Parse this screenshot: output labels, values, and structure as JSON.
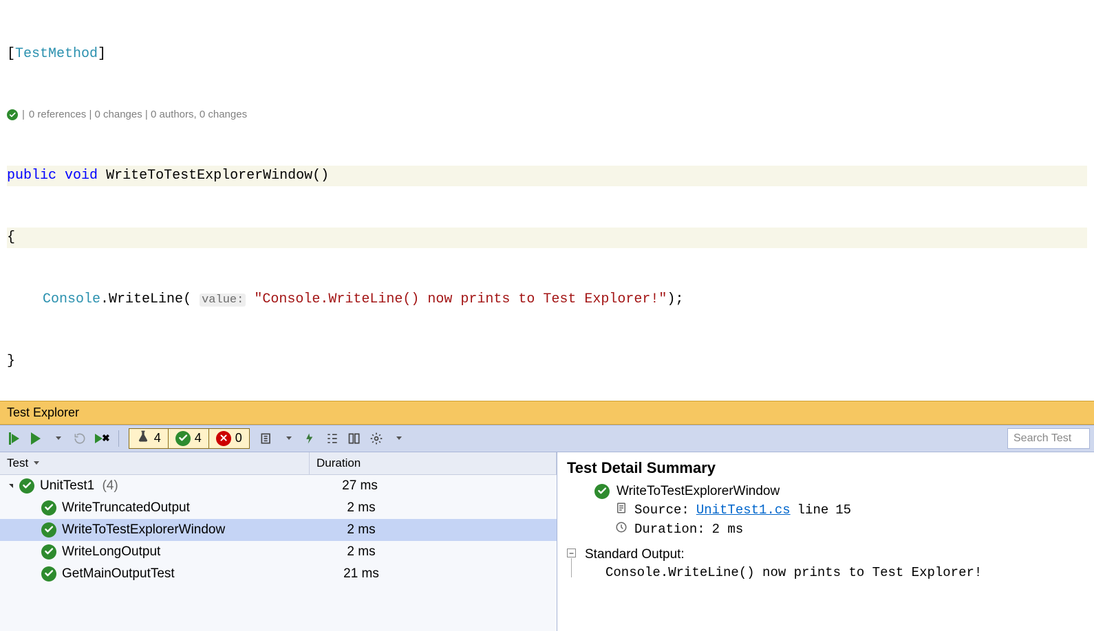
{
  "code": {
    "attr_open": "[",
    "attr_name": "TestMethod",
    "attr_close": "]",
    "codelens": "0 references | 0 changes | 0 authors, 0 changes",
    "kw_public": "public",
    "kw_void": "void",
    "method_name": "WriteToTestExplorerWindow",
    "parens": "()",
    "brace_open": "{",
    "console": "Console",
    "dot": ".",
    "writeline": "WriteLine",
    "open_paren": "(",
    "param_hint": "value:",
    "string_literal": "\"Console.WriteLine() now prints to Test Explorer!\"",
    "close_call": ");",
    "brace_close": "}"
  },
  "testExplorer": {
    "title": "Test Explorer",
    "counts": {
      "total": "4",
      "passed": "4",
      "failed": "0"
    },
    "search_placeholder": "Search Test",
    "columns": {
      "test": "Test",
      "duration": "Duration"
    },
    "group": {
      "name": "UnitTest1",
      "count": "(4)",
      "duration": "27 ms"
    },
    "tests": [
      {
        "name": "WriteTruncatedOutput",
        "duration": "2 ms",
        "selected": false
      },
      {
        "name": "WriteToTestExplorerWindow",
        "duration": "2 ms",
        "selected": true
      },
      {
        "name": "WriteLongOutput",
        "duration": "2 ms",
        "selected": false
      },
      {
        "name": "GetMainOutputTest",
        "duration": "21 ms",
        "selected": false
      }
    ]
  },
  "detail": {
    "heading": "Test Detail Summary",
    "test_name": "WriteToTestExplorerWindow",
    "source_label": "Source:",
    "source_file": "UnitTest1.cs",
    "source_line_prefix": "line",
    "source_line": "15",
    "duration_label": "Duration:",
    "duration_value": "2 ms",
    "stdout_label": "Standard Output:",
    "stdout_value": "Console.WriteLine() now prints to Test Explorer!"
  }
}
